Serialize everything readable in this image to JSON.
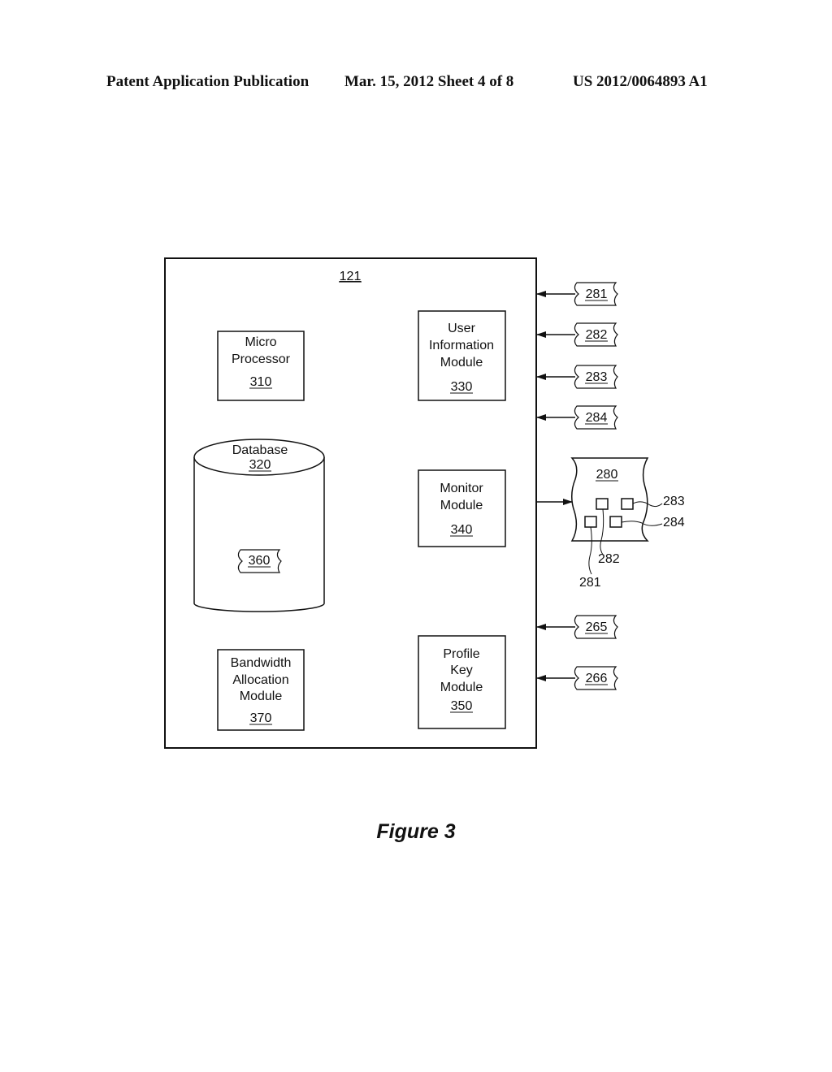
{
  "header": {
    "left": "Patent Application Publication",
    "middle": "Mar. 15, 2012  Sheet 4 of 8",
    "right": "US 2012/0064893 A1"
  },
  "diagram": {
    "container_ref": "121",
    "micro_processor": {
      "lines": [
        "Micro",
        "Processor"
      ],
      "ref": "310"
    },
    "database": {
      "lines": [
        "Database"
      ],
      "ref": "320",
      "inner_ref": "360"
    },
    "user_info_module": {
      "lines": [
        "User",
        "Information",
        "Module"
      ],
      "ref": "330"
    },
    "monitor_module": {
      "lines": [
        "Monitor",
        "Module"
      ],
      "ref": "340"
    },
    "profile_key_module": {
      "lines": [
        "Profile",
        "Key",
        "Module"
      ],
      "ref": "350"
    },
    "bandwidth_module": {
      "lines": [
        "Bandwidth",
        "Allocation",
        "Module"
      ],
      "ref": "370"
    },
    "inputs": [
      "281",
      "282",
      "283",
      "284",
      "265",
      "266"
    ],
    "output_doc": {
      "ref": "280",
      "callouts": [
        "283",
        "284",
        "282",
        "281"
      ]
    }
  },
  "figure_caption": "Figure 3"
}
